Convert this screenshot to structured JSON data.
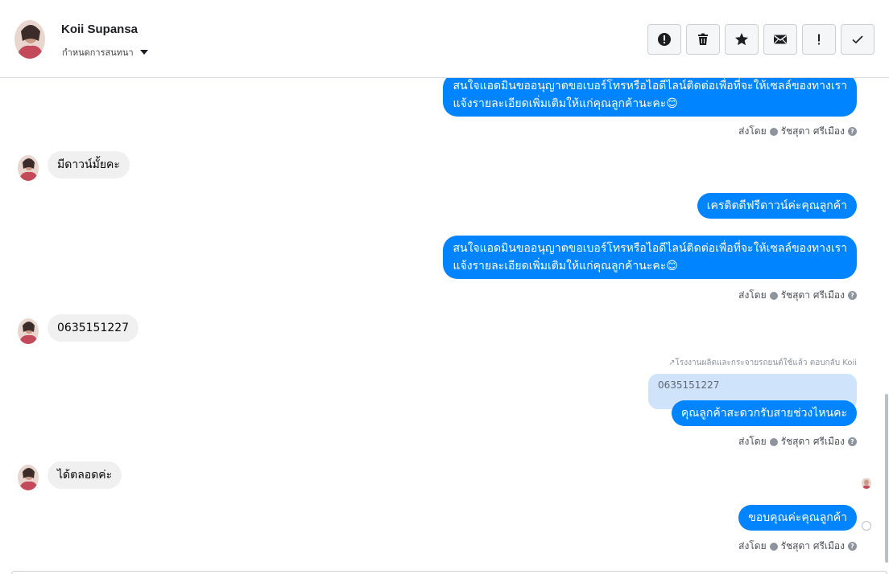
{
  "header": {
    "contact_name": "Koii Supansa",
    "assign_label": "กำหนดการสนทนา",
    "toolbar": [
      {
        "name": "spam-button",
        "icon": "alert-circle-icon"
      },
      {
        "name": "delete-button",
        "icon": "trash-icon"
      },
      {
        "name": "star-button",
        "icon": "star-icon"
      },
      {
        "name": "mark-unread-button",
        "icon": "envelope-icon"
      },
      {
        "name": "follow-up-button",
        "icon": "exclamation-icon"
      },
      {
        "name": "mark-done-button",
        "icon": "check-icon"
      }
    ]
  },
  "colors": {
    "outgoing_bubble": "#0084ff",
    "incoming_bubble": "#f0f0f0",
    "quote_bg": "#cfe3fb"
  },
  "messages": {
    "m1_out": "สนใจแอดมินขออนุญาตขอเบอร์โทรหรือไอดีไลน์ติดต่อเพื่อที่จะให้เซลล์ของทางเรา\nแจ้งรายละเอียดเพิ่มเติมให้แก่คุณลูกค้านะคะ😊",
    "m2_in": "มีดาวน์มั้ยคะ",
    "m3_out": "เครดิตดีฟรีดาวน์ค่ะคุณลูกค้า",
    "m4_out": "สนใจแอดมินขออนุญาตขอเบอร์โทรหรือไอดีไลน์ติดต่อเพื่อที่จะให้เซลล์ของทางเรา\nแจ้งรายละเอียดเพิ่มเติมให้แก่คุณลูกค้านะคะ😊",
    "m5_in": "0635151227",
    "reply_note": "↗โรงงานผลิตและกระจายรถยนต์ใช้แล้ว ตอบกลับ Koii",
    "quoted_text": "0635151227",
    "m6_out": "คุณลูกค้าสะดวกรับสายช่วงไหนคะ",
    "m7_in": "ได้ตลอดค่ะ",
    "m8_out": "ขอบคุณค่ะคุณลูกค้า"
  },
  "sent_by": {
    "prefix": "ส่งโดย",
    "agent": "รัชสุดา ศรีเมือง",
    "help": "?"
  }
}
